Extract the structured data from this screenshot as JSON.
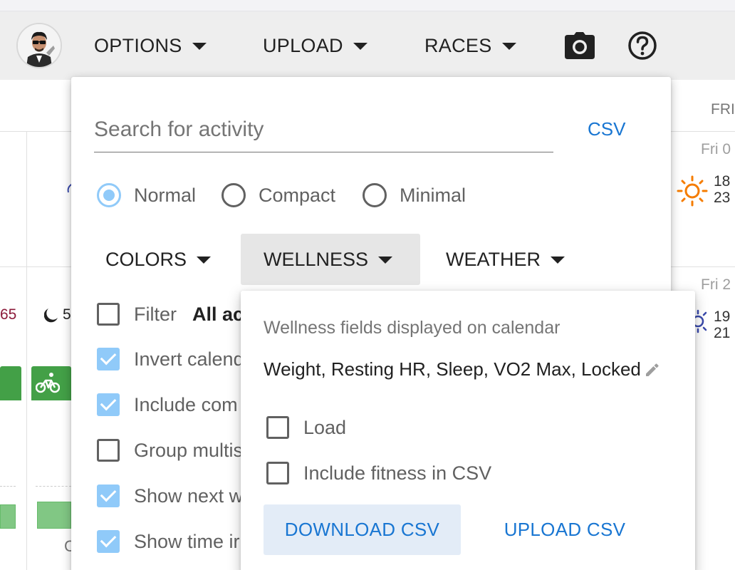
{
  "toolbar": {
    "options_label": "OPTIONS",
    "upload_label": "UPLOAD",
    "races_label": "RACES",
    "camera_icon": "camera-icon",
    "help_icon": "help-circle-icon"
  },
  "calendar": {
    "day_header": "FRI",
    "dates": [
      "Fri 0",
      "Fri 2"
    ],
    "temps": [
      [
        "18",
        "23"
      ],
      [
        "19",
        "21"
      ]
    ],
    "left_value": "65",
    "moon_value": "5",
    "partial_text": "C"
  },
  "options_panel": {
    "search_placeholder": "Search for activity",
    "csv_label": "CSV",
    "view_modes": [
      {
        "label": "Normal",
        "selected": true
      },
      {
        "label": "Compact",
        "selected": false
      },
      {
        "label": "Minimal",
        "selected": false
      }
    ],
    "submenus": {
      "colors": "COLORS",
      "wellness": "WELLNESS",
      "weather": "WEATHER"
    },
    "checkboxes": [
      {
        "label": "Filter",
        "checked": false
      },
      {
        "label": "Invert calend",
        "checked": true
      },
      {
        "label": "Include com",
        "checked": true
      },
      {
        "label": "Group multis",
        "checked": false
      },
      {
        "label": "Show next w",
        "checked": true
      },
      {
        "label": "Show time ir",
        "checked": true
      }
    ],
    "filter_value": "All act"
  },
  "wellness_dropdown": {
    "caption": "Wellness fields displayed on calendar",
    "fields": "Weight, Resting HR, Sleep, VO2 Max, Locked",
    "load_label": "Load",
    "load_checked": false,
    "include_fitness_label": "Include fitness in CSV",
    "include_fitness_checked": false,
    "download_label": "DOWNLOAD CSV",
    "upload_label": "UPLOAD CSV"
  },
  "colors": {
    "accent": "#1976d2",
    "checkbox_on": "#90caf9",
    "activity_green": "#43a047",
    "sun": "#f57c00"
  }
}
